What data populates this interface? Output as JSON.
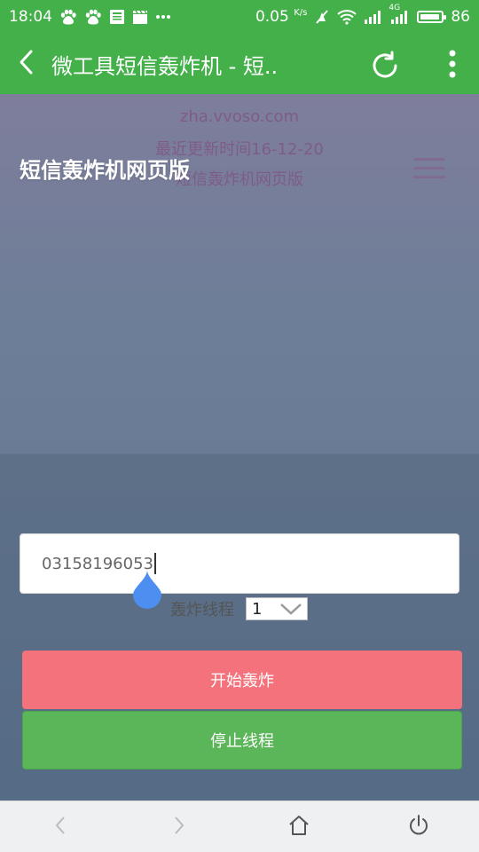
{
  "status_bar": {
    "time": "18:04",
    "net_speed": "0.05",
    "net_unit": "K/s",
    "network_type": "4G",
    "battery": "86",
    "icons": [
      "paw-icon",
      "paw-icon",
      "news-icon",
      "clapper-icon",
      "more-dots-icon",
      "no-alarm-icon",
      "wifi-icon",
      "signal-icon",
      "signal-4g-icon",
      "battery-icon"
    ]
  },
  "toolbar": {
    "title": "微工具短信轰炸机 - 短..",
    "accent": "#43b04a"
  },
  "page": {
    "domain": "zha.vvoso.com",
    "updated": "最近更新时间16-12-20",
    "subtitle": "短信轰炸机网页版",
    "site_title": "短信轰炸机网页版"
  },
  "form": {
    "phone_value": "03158196053",
    "thread_label": "轰炸线程",
    "thread_selected": "1",
    "start_label": "开始轰炸",
    "stop_label": "停止线程",
    "start_color": "#f4727b",
    "stop_color": "#5bb65a"
  },
  "nav": {
    "icons": [
      "back-arrow-icon",
      "forward-arrow-icon",
      "home-icon",
      "power-icon"
    ]
  }
}
